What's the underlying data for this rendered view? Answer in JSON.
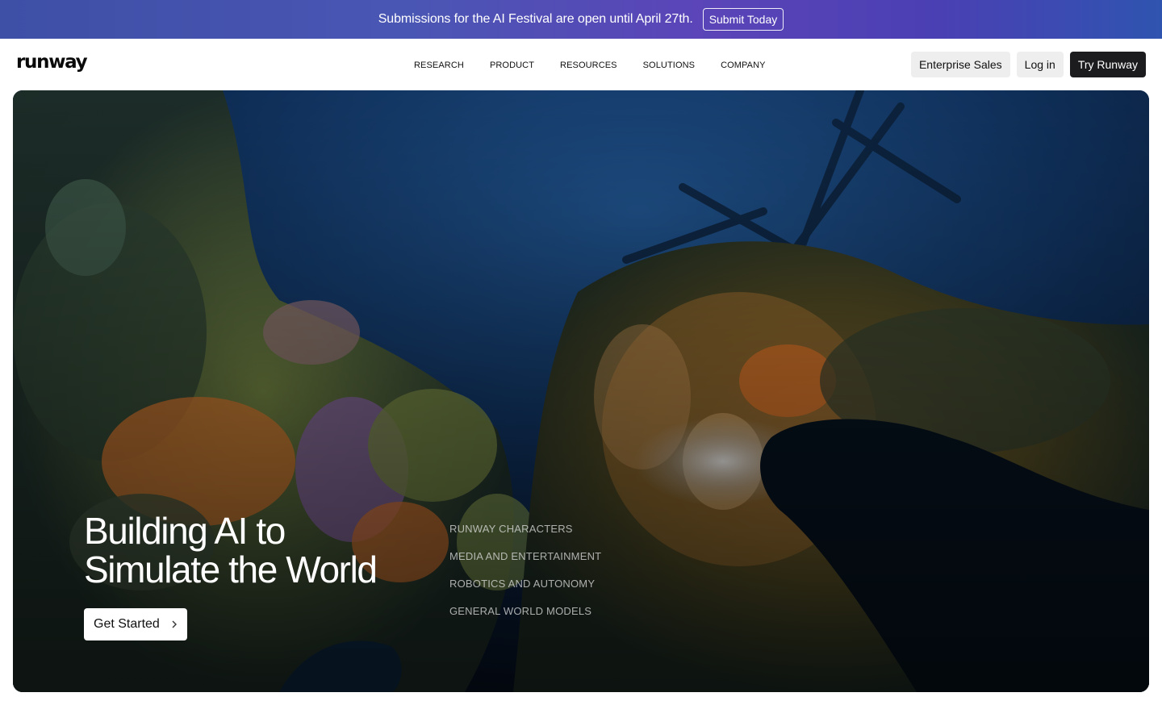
{
  "banner": {
    "text": "Submissions for the AI Festival are open until April 27th.",
    "button_label": "Submit Today"
  },
  "header": {
    "logo_text": "runway",
    "nav": [
      "RESEARCH",
      "PRODUCT",
      "RESOURCES",
      "SOLUTIONS",
      "COMPANY"
    ],
    "actions": {
      "enterprise_label": "Enterprise Sales",
      "login_label": "Log in",
      "try_label": "Try Runway"
    }
  },
  "hero": {
    "title_line1": "Building AI to",
    "title_line2": "Simulate the World",
    "cta_label": "Get Started",
    "cta_icon": "chevron-right-icon",
    "use_cases": [
      "RUNWAY CHARACTERS",
      "MEDIA AND ENTERTAINMENT",
      "ROBOTICS AND AUTONOMY",
      "GENERAL WORLD MODELS"
    ]
  },
  "colors": {
    "banner_gradient_start": "#3e4fa6",
    "banner_gradient_end": "#2f54b0",
    "dark_button": "#1c1c1e",
    "light_button": "#eeeeee",
    "hero_water": "#0a2140"
  }
}
